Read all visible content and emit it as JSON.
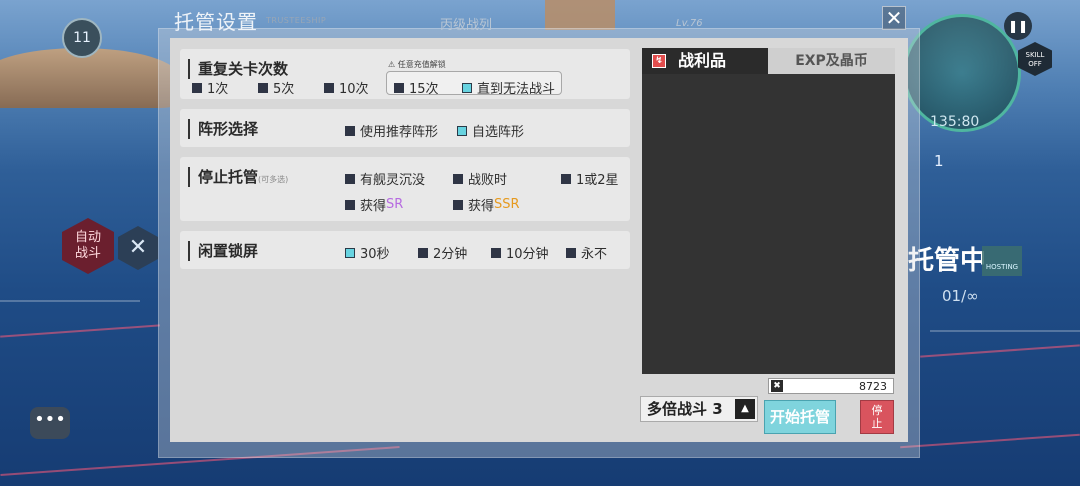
{
  "hud": {
    "avatar_level": "11",
    "auto_battle": "自动\n战斗",
    "chat_icon": "•••",
    "radar_time": "135:80",
    "skill_off": "SKILL\nOFF",
    "wave_count": "1",
    "hosting_label": "托管中",
    "hosting_tag": "HOSTING",
    "round_count": "01/∞"
  },
  "modal": {
    "title": "托管设置",
    "subtitle": "TRUSTEESHIP",
    "ghost_fleet": "丙级战列",
    "ghost_level": "Lv.76",
    "close_icon": "✕"
  },
  "repeat": {
    "heading": "重复关卡次数",
    "hint": "任意充值解锁",
    "options": [
      "1次",
      "5次",
      "10次",
      "15次",
      "直到无法战斗"
    ],
    "selected": "直到无法战斗"
  },
  "formation": {
    "heading": "阵形选择",
    "options": [
      "使用推荐阵形",
      "自选阵形"
    ],
    "selected": "自选阵形"
  },
  "stop": {
    "heading": "停止托管",
    "heading_note": "(可多选)",
    "options": [
      "有舰灵沉没",
      "战败时",
      "1或2星"
    ],
    "obtain_label": "获得",
    "sr": "SR",
    "ssr": "SSR"
  },
  "lock": {
    "heading": "闲置锁屏",
    "options": [
      "30秒",
      "2分钟",
      "10分钟",
      "永不"
    ],
    "selected": "30秒"
  },
  "loot": {
    "tab_loot": "战利品",
    "tab_exp": "EXP及晶币",
    "active_tab": "战利品"
  },
  "footer": {
    "oil_value": "8723",
    "multi_label": "多倍战斗 3",
    "multi_up_icon": "▲",
    "start_label": "开始托管",
    "stop_label": "停\n止"
  }
}
